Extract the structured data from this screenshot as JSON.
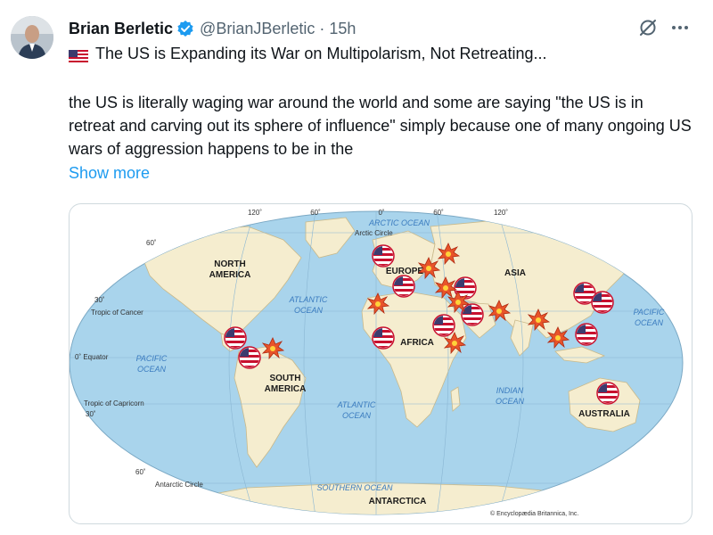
{
  "post": {
    "author_name": "Brian Berletic",
    "handle": "@BrianJBerletic",
    "separator": "·",
    "time": "15h",
    "title": "The US is Expanding its War on Multipolarism, Not Retreating...",
    "body": "the US is literally waging war around the world and some are saying \"the US is  in retreat and carving out its sphere of influence\" simply because one of many ongoing US wars of aggression happens to be in the",
    "show_more": "Show more",
    "icons": [
      "verified-badge-icon",
      "grok-icon",
      "more-icon",
      "us-flag-emoji"
    ],
    "colors": {
      "link": "#1d9bf0",
      "verified": "#1d9bf0",
      "secondary_text": "#536471"
    }
  },
  "map": {
    "longitudes": [
      "120˚",
      "60˚",
      "0˚",
      "60˚",
      "120˚"
    ],
    "latitudes": [
      "60˚",
      "30˚",
      "0˚ Equator",
      "30˚",
      "60˚"
    ],
    "lines": {
      "arctic": "Arctic Circle",
      "cancer": "Tropic of Cancer",
      "capricorn": "Tropic of Capricorn",
      "antarctic": "Antarctic Circle"
    },
    "oceans": {
      "arctic": "ARCTIC OCEAN",
      "atlantic_n1": "ATLANTIC",
      "atlantic_n2": "OCEAN",
      "pacific_w1": "PACIFIC",
      "pacific_w2": "OCEAN",
      "pacific_e1": "PACIFIC",
      "pacific_e2": "OCEAN",
      "atlantic_s1": "ATLANTIC",
      "atlantic_s2": "OCEAN",
      "indian1": "INDIAN",
      "indian2": "OCEAN",
      "southern": "SOUTHERN OCEAN"
    },
    "continents": {
      "na1": "NORTH",
      "na2": "AMERICA",
      "europe": "EUROPE",
      "asia": "ASIA",
      "africa": "AFRICA",
      "sa1": "SOUTH",
      "sa2": "AMERICA",
      "australia": "AUSTRALIA",
      "antarctica": "ANTARCTICA"
    },
    "credit": "© Encyclopædia Britannica, Inc.",
    "colors": {
      "ocean": "#a9d4ec",
      "land": "#f5edcf",
      "label": "#3a7bbf"
    }
  }
}
